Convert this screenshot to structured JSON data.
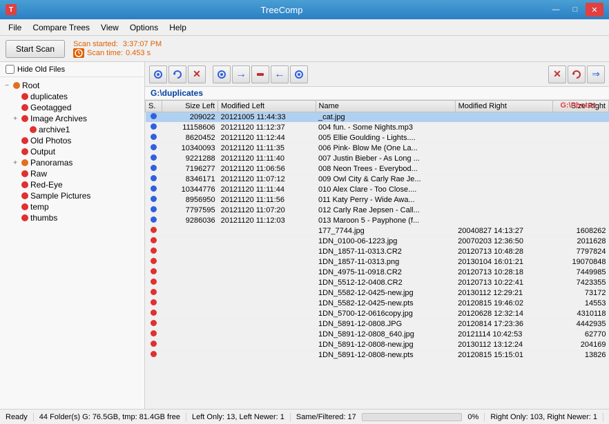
{
  "titleBar": {
    "icon": "T",
    "title": "TreeComp",
    "minimize": "—",
    "maximize": "□",
    "close": "✕"
  },
  "menuBar": {
    "items": [
      "File",
      "Compare Trees",
      "View",
      "Options",
      "Help"
    ]
  },
  "toolbar": {
    "scanButton": "Start Scan",
    "scanStarted": "Scan started:",
    "scanTime": "Scan time:",
    "scanStartValue": "3:37:07 PM",
    "scanTimeValue": "0.453 s"
  },
  "paths": {
    "left": "G:\\duplicates",
    "right": "G:\\Photos"
  },
  "treeItems": [
    {
      "label": "Root",
      "indent": 0,
      "toggle": "−",
      "dot": "orange",
      "id": "root"
    },
    {
      "label": "duplicates",
      "indent": 1,
      "toggle": "",
      "dot": "red",
      "id": "duplicates"
    },
    {
      "label": "Geotagged",
      "indent": 1,
      "toggle": "",
      "dot": "red",
      "id": "geotagged"
    },
    {
      "label": "Image Archives",
      "indent": 1,
      "toggle": "+",
      "dot": "red",
      "id": "image-archives"
    },
    {
      "label": "archive1",
      "indent": 2,
      "toggle": "",
      "dot": "red",
      "id": "archive1"
    },
    {
      "label": "Old Photos",
      "indent": 1,
      "toggle": "",
      "dot": "red",
      "id": "old-photos"
    },
    {
      "label": "Output",
      "indent": 1,
      "toggle": "",
      "dot": "red",
      "id": "output"
    },
    {
      "label": "Panoramas",
      "indent": 1,
      "toggle": "+",
      "dot": "orange",
      "id": "panoramas"
    },
    {
      "label": "Raw",
      "indent": 1,
      "toggle": "",
      "dot": "red",
      "id": "raw"
    },
    {
      "label": "Red-Eye",
      "indent": 1,
      "toggle": "",
      "dot": "red",
      "id": "red-eye"
    },
    {
      "label": "Sample Pictures",
      "indent": 1,
      "toggle": "",
      "dot": "red",
      "id": "sample-pictures"
    },
    {
      "label": "temp",
      "indent": 1,
      "toggle": "",
      "dot": "red",
      "id": "temp"
    },
    {
      "label": "thumbs",
      "indent": 1,
      "toggle": "",
      "dot": "red",
      "id": "thumbs"
    }
  ],
  "tableHeaders": {
    "indicator": "S.",
    "sizeLeft": "Size Left",
    "modLeft": "Modified Left",
    "name": "Name",
    "modRight": "Modified Right",
    "sizeRight": "Size Right"
  },
  "tableRows": [
    {
      "ind": "blue-both",
      "sizeLeft": "209022",
      "modLeft": "20121005 11:44:33",
      "name": "_cat.jpg",
      "modRight": "",
      "sizeRight": "",
      "selected": true
    },
    {
      "ind": "blue-both",
      "sizeLeft": "11158606",
      "modLeft": "20121120 11:12:37",
      "name": "004 fun. - Some Nights.mp3",
      "modRight": "",
      "sizeRight": ""
    },
    {
      "ind": "blue-both",
      "sizeLeft": "8620452",
      "modLeft": "20121120 11:12:44",
      "name": "005 Ellie Goulding - Lights....",
      "modRight": "",
      "sizeRight": ""
    },
    {
      "ind": "blue-both",
      "sizeLeft": "10340093",
      "modLeft": "20121120 11:11:35",
      "name": "006 Pink- Blow Me (One La...",
      "modRight": "",
      "sizeRight": ""
    },
    {
      "ind": "blue-both",
      "sizeLeft": "9221288",
      "modLeft": "20121120 11:11:40",
      "name": "007 Justin Bieber - As Long ...",
      "modRight": "",
      "sizeRight": ""
    },
    {
      "ind": "blue-both",
      "sizeLeft": "7196277",
      "modLeft": "20121120 11:06:56",
      "name": "008 Neon Trees - Everybod...",
      "modRight": "",
      "sizeRight": ""
    },
    {
      "ind": "blue-both",
      "sizeLeft": "8346171",
      "modLeft": "20121120 11:07:12",
      "name": "009 Owl City & Carly Rae Je...",
      "modRight": "",
      "sizeRight": ""
    },
    {
      "ind": "blue-both",
      "sizeLeft": "10344776",
      "modLeft": "20121120 11:11:44",
      "name": "010 Alex Clare - Too Close....",
      "modRight": "",
      "sizeRight": ""
    },
    {
      "ind": "blue-both",
      "sizeLeft": "8956950",
      "modLeft": "20121120 11:11:56",
      "name": "011 Katy Perry - Wide Awa...",
      "modRight": "",
      "sizeRight": ""
    },
    {
      "ind": "blue-both",
      "sizeLeft": "7797595",
      "modLeft": "20121120 11:07:20",
      "name": "012 Carly Rae Jepsen - Call...",
      "modRight": "",
      "sizeRight": ""
    },
    {
      "ind": "blue-both",
      "sizeLeft": "9286036",
      "modLeft": "20121120 11:12:03",
      "name": "013 Maroon 5 - Payphone (f...",
      "modRight": "",
      "sizeRight": ""
    },
    {
      "ind": "red-right",
      "sizeLeft": "",
      "modLeft": "",
      "name": "177_7744.jpg",
      "modRight": "20040827 14:13:27",
      "sizeRight": "1608262"
    },
    {
      "ind": "red-right",
      "sizeLeft": "",
      "modLeft": "",
      "name": "1DN_0100-06-1223.jpg",
      "modRight": "20070203 12:36:50",
      "sizeRight": "2011628"
    },
    {
      "ind": "red-right",
      "sizeLeft": "",
      "modLeft": "",
      "name": "1DN_1857-11-0313.CR2",
      "modRight": "20120713 10:48:28",
      "sizeRight": "7797824"
    },
    {
      "ind": "red-right",
      "sizeLeft": "",
      "modLeft": "",
      "name": "1DN_1857-11-0313.png",
      "modRight": "20130104 16:01:21",
      "sizeRight": "19070848"
    },
    {
      "ind": "red-right",
      "sizeLeft": "",
      "modLeft": "",
      "name": "1DN_4975-11-0918.CR2",
      "modRight": "20120713 10:28:18",
      "sizeRight": "7449985"
    },
    {
      "ind": "red-right",
      "sizeLeft": "",
      "modLeft": "",
      "name": "1DN_5512-12-0408.CR2",
      "modRight": "20120713 10:22:41",
      "sizeRight": "7423355"
    },
    {
      "ind": "red-right",
      "sizeLeft": "",
      "modLeft": "",
      "name": "1DN_5582-12-0425-new.jpg",
      "modRight": "20130112 12:29:21",
      "sizeRight": "73172"
    },
    {
      "ind": "red-right",
      "sizeLeft": "",
      "modLeft": "",
      "name": "1DN_5582-12-0425-new.pts",
      "modRight": "20120815 19:46:02",
      "sizeRight": "14553"
    },
    {
      "ind": "red-right",
      "sizeLeft": "",
      "modLeft": "",
      "name": "1DN_5700-12-0616copy.jpg",
      "modRight": "20120628 12:32:14",
      "sizeRight": "4310118"
    },
    {
      "ind": "red-right",
      "sizeLeft": "",
      "modLeft": "",
      "name": "1DN_5891-12-0808.JPG",
      "modRight": "20120814 17:23:36",
      "sizeRight": "4442935"
    },
    {
      "ind": "red-right",
      "sizeLeft": "",
      "modLeft": "",
      "name": "1DN_5891-12-0808_640.jpg",
      "modRight": "20121114 10:42:53",
      "sizeRight": "62770"
    },
    {
      "ind": "red-right",
      "sizeLeft": "",
      "modLeft": "",
      "name": "1DN_5891-12-0808-new.jpg",
      "modRight": "20130112 13:12:24",
      "sizeRight": "204169"
    },
    {
      "ind": "red-right",
      "sizeLeft": "",
      "modLeft": "",
      "name": "1DN_5891-12-0808-new.pts",
      "modRight": "20120815 15:15:01",
      "sizeRight": "13826"
    }
  ],
  "statusBar": {
    "ready": "Ready",
    "diskInfo": "44 Folder(s) G: 76.5GB, tmp: 81.4GB free",
    "leftOnly": "Left Only: 13, Left Newer: 1",
    "sameFiltered": "Same/Filtered: 17",
    "rightOnly": "Right Only: 103, Right Newer: 1",
    "progress": "0%"
  },
  "toolbar2Buttons": [
    {
      "icon": "◉",
      "name": "mark-button",
      "title": "Mark"
    },
    {
      "icon": "↺",
      "name": "refresh-button",
      "title": "Refresh"
    },
    {
      "icon": "✕",
      "name": "clear-button",
      "title": "Clear"
    },
    {
      "icon": "◉",
      "name": "left-mark-button",
      "title": "Left Mark",
      "color": "blue"
    },
    {
      "icon": "→",
      "name": "copy-right-button",
      "title": "Copy Right",
      "color": "blue"
    },
    {
      "icon": "◆",
      "name": "center-button",
      "title": "Center",
      "color": "#c03030"
    },
    {
      "icon": "←",
      "name": "copy-left-button",
      "title": "Copy Left",
      "color": "blue"
    },
    {
      "icon": "◉",
      "name": "right-mark-button",
      "title": "Right Mark",
      "color": "blue"
    },
    {
      "icon": "✕",
      "name": "delete-right-button",
      "title": "Delete Right",
      "color": "#c03030"
    },
    {
      "icon": "↺",
      "name": "delete-refresh-button",
      "title": "Delete Refresh",
      "color": "#c03030"
    }
  ]
}
